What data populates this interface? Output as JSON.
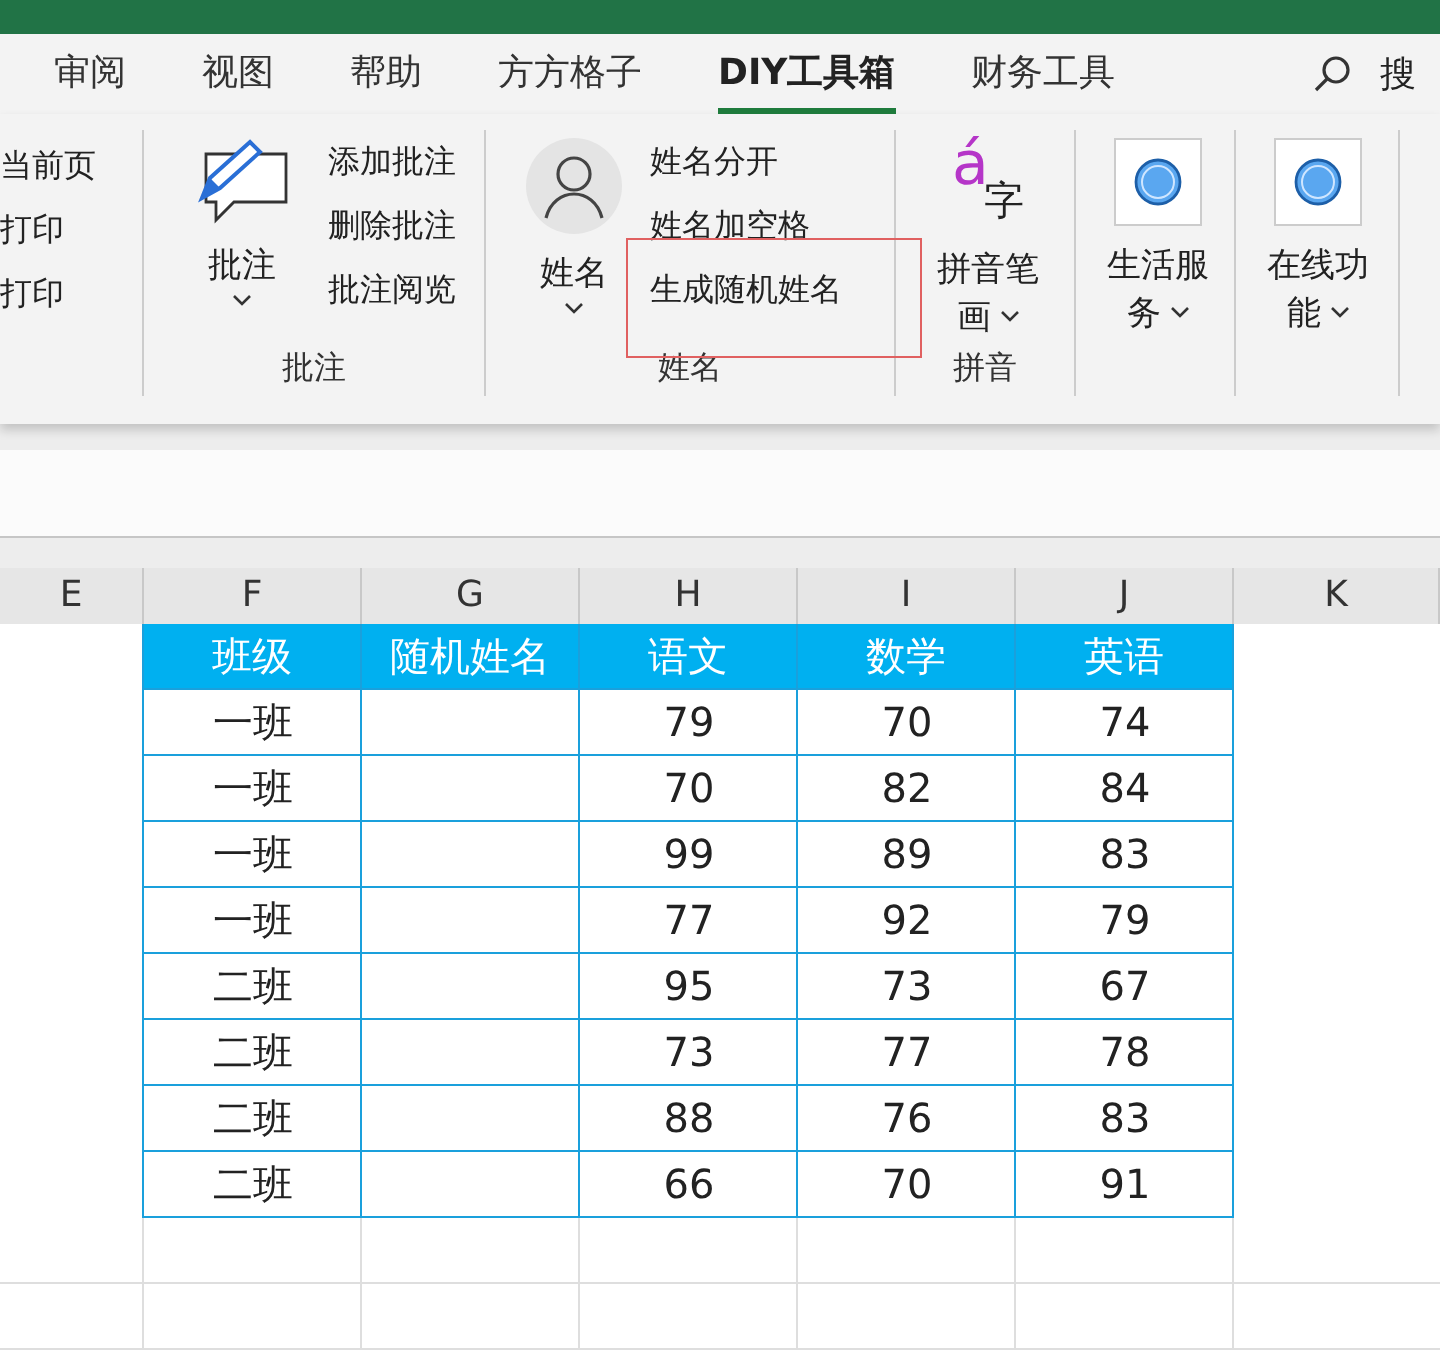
{
  "tabs": [
    {
      "label": "审阅",
      "selected": false
    },
    {
      "label": "视图",
      "selected": false
    },
    {
      "label": "帮助",
      "selected": false
    },
    {
      "label": "方方格子",
      "selected": false
    },
    {
      "label": "DIY工具箱",
      "selected": true
    },
    {
      "label": "财务工具",
      "selected": false
    }
  ],
  "search": {
    "label": "搜"
  },
  "ribbon_groups": [
    {
      "kind": "list",
      "items": [
        {
          "label": "当前页",
          "highlighted": false
        },
        {
          "label": "打印",
          "highlighted": false
        },
        {
          "label": "打印",
          "highlighted": false
        }
      ]
    },
    {
      "kind": "comment",
      "button": "批注",
      "label": "批注",
      "items": [
        {
          "label": "添加批注",
          "highlighted": false
        },
        {
          "label": "删除批注",
          "highlighted": false
        },
        {
          "label": "批注阅览",
          "highlighted": false
        }
      ]
    },
    {
      "kind": "person",
      "button": "姓名",
      "label": "姓名",
      "items": [
        {
          "label": "姓名分开",
          "highlighted": false
        },
        {
          "label": "姓名加空格",
          "highlighted": false
        },
        {
          "label": "生成随机姓名",
          "highlighted": true
        }
      ]
    },
    {
      "kind": "pinyin",
      "icon_letter": "á",
      "icon_char": "字",
      "button": "拼音笔画",
      "label": "拼音"
    },
    {
      "kind": "circle",
      "button": "生活服务"
    },
    {
      "kind": "circle",
      "button": "在线功能"
    }
  ],
  "sheet": {
    "columns": [
      "E",
      "F",
      "G",
      "H",
      "I",
      "J",
      "K"
    ],
    "rows": [
      {
        "header": true,
        "cells": [
          "",
          "班级",
          "随机姓名",
          "语文",
          "数学",
          "英语",
          ""
        ]
      },
      {
        "header": false,
        "cells": [
          "",
          "一班",
          "",
          "79",
          "70",
          "74",
          ""
        ]
      },
      {
        "header": false,
        "cells": [
          "",
          "一班",
          "",
          "70",
          "82",
          "84",
          ""
        ]
      },
      {
        "header": false,
        "cells": [
          "",
          "一班",
          "",
          "99",
          "89",
          "83",
          ""
        ]
      },
      {
        "header": false,
        "cells": [
          "",
          "一班",
          "",
          "77",
          "92",
          "79",
          ""
        ]
      },
      {
        "header": false,
        "cells": [
          "",
          "二班",
          "",
          "95",
          "73",
          "67",
          ""
        ]
      },
      {
        "header": false,
        "cells": [
          "",
          "二班",
          "",
          "73",
          "77",
          "78",
          ""
        ]
      },
      {
        "header": false,
        "cells": [
          "",
          "二班",
          "",
          "88",
          "76",
          "83",
          ""
        ]
      },
      {
        "header": false,
        "cells": [
          "",
          "二班",
          "",
          "66",
          "70",
          "91",
          ""
        ]
      }
    ]
  }
}
